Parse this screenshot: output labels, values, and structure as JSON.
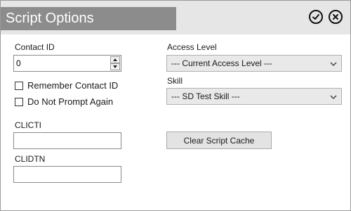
{
  "window": {
    "title": "Script Options"
  },
  "titlebar_buttons": {
    "ok_icon": "check-circle-icon",
    "close_icon": "close-circle-icon"
  },
  "form": {
    "contact_id": {
      "label": "Contact ID",
      "value": "0"
    },
    "remember_contact_id": {
      "label": "Remember Contact ID",
      "checked": false
    },
    "do_not_prompt_again": {
      "label": "Do Not Prompt Again",
      "checked": false
    },
    "clicti": {
      "label": "CLICTI",
      "value": ""
    },
    "clidtn": {
      "label": "CLIDTN",
      "value": ""
    },
    "access_level": {
      "label": "Access Level",
      "selected": "--- Current Access Level ---"
    },
    "skill": {
      "label": "Skill",
      "selected": "--- SD Test Skill ---"
    },
    "clear_cache_button": "Clear Script Cache"
  },
  "colors": {
    "titlebar_bg": "#e6e6e6",
    "title_block_bg": "#8c8c8c",
    "dropdown_bg": "#e9e9e9",
    "button_bg": "#e3e3e3"
  }
}
